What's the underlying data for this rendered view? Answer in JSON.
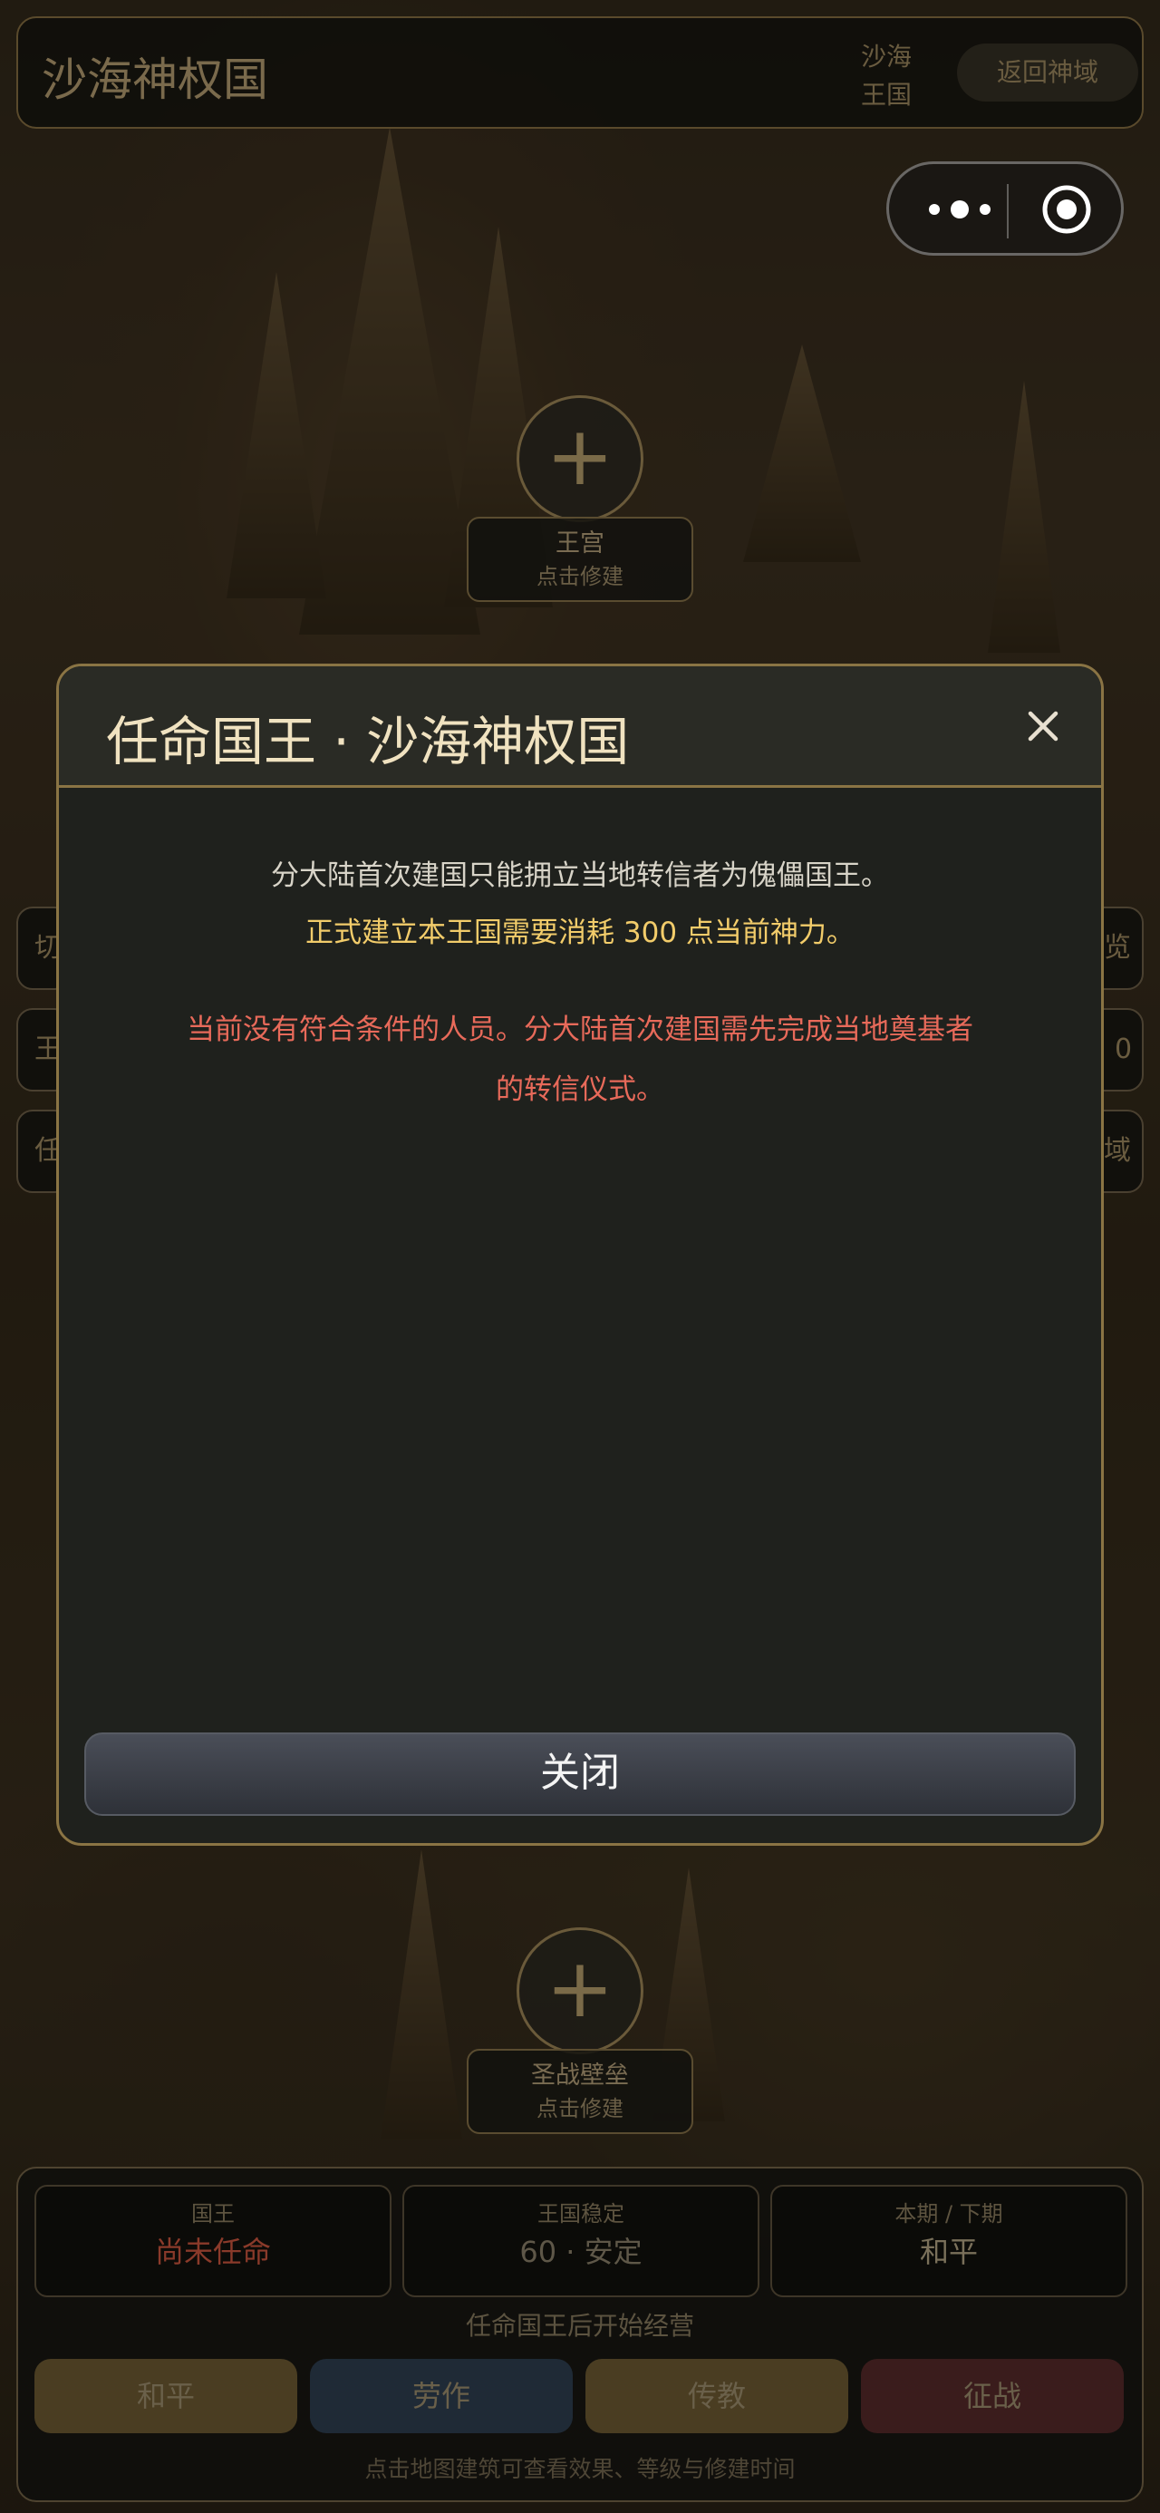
{
  "topbar": {
    "title": "沙海神权国",
    "sub_line1": "沙海",
    "sub_line2": "王国",
    "back_label": "返回神域"
  },
  "buildings": {
    "palace": {
      "name": "王宫",
      "hint": "点击修建"
    },
    "fortress": {
      "name": "圣战壁垒",
      "hint": "点击修建"
    }
  },
  "side": {
    "left1": "切",
    "left2": "王",
    "left3": "任",
    "right1": "览",
    "right2": "0",
    "right3": "域"
  },
  "modal": {
    "title": "任命国王 · 沙海神权国",
    "line1": "分大陆首次建国只能拥立当地转信者为傀儡国王。",
    "line2": "正式建立本王国需要消耗 300 点当前神力。",
    "warn_line1": "当前没有符合条件的人员。分大陆首次建国需先完成当地奠基者",
    "warn_line2": "的转信仪式。",
    "close_label": "关闭"
  },
  "panel": {
    "stats": [
      {
        "key": "国王",
        "value": "尚未任命",
        "color": "#8a3a2a"
      },
      {
        "key": "王国稳定",
        "value": "60 · 安定",
        "color": "#5e5748"
      },
      {
        "key": "本期 / 下期",
        "value": "和平",
        "color": "#7a705a"
      }
    ],
    "hint_top": "任命国王后开始经营",
    "actions": [
      {
        "label": "和平",
        "bg": "#4a3d22"
      },
      {
        "label": "劳作",
        "bg": "#1f2a36"
      },
      {
        "label": "传教",
        "bg": "#4a3d22"
      },
      {
        "label": "征战",
        "bg": "#3a1c1c"
      }
    ],
    "hint_bottom": "点击地图建筑可查看效果、等级与修建时间"
  },
  "icons": {
    "menu": "more-dots-icon",
    "capsule_close": "target-circle-icon",
    "close": "close-x-icon",
    "add": "plus-icon"
  }
}
